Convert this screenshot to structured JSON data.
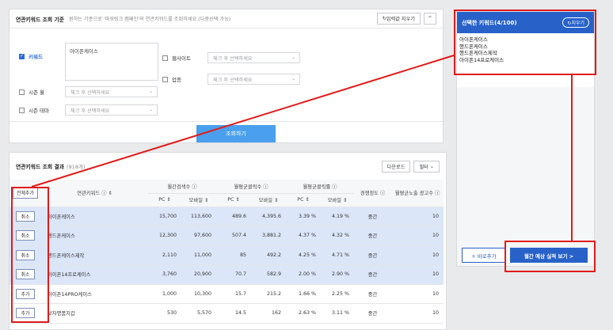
{
  "search": {
    "title": "연관키워드 조회 기준",
    "subtitle": "원하는 기준으로 '파워링크 캠페인'의 연관키워드를 조회하세요.(다중선택 가능)",
    "reset_label": "입력값 지우기",
    "collapse_label": "^",
    "keyword_label": "키워드",
    "keyword_value": "아이폰케이스",
    "website_label": "웹사이트",
    "website_placeholder": "체크 후 선택하세요",
    "business_label": "업종",
    "business_placeholder": "체크 후 선택하세요",
    "season_month_label": "시즌 월",
    "season_month_placeholder": "체크 후 선택하세요",
    "season_theme_label": "시즌 테마",
    "season_theme_placeholder": "체크 후 선택하세요",
    "search_button": "조회하기"
  },
  "results": {
    "title": "연관키워드 조회 결과",
    "count": "(918개)",
    "download_label": "다운로드",
    "filter_label": "필터",
    "add_all_label": "전체추가",
    "col_keyword": "연관키워드",
    "col_monthly_search": "월간검색수",
    "col_monthly_clicks": "월평균클릭수",
    "col_monthly_ctr": "월평균클릭률",
    "col_competition": "경쟁정도",
    "col_ad_count": "월평균노출 광고수",
    "sub_pc": "PC",
    "sub_mobile": "모바일",
    "rows": [
      {
        "action": "취소",
        "keyword": "아이폰케이스",
        "pc_search": "15,700",
        "mo_search": "113,600",
        "pc_click": "489.6",
        "mo_click": "4,395.6",
        "pc_ctr": "3.39 %",
        "mo_ctr": "4.19 %",
        "competition": "중간",
        "ads": "10",
        "selected": true
      },
      {
        "action": "취소",
        "keyword": "핸드폰케이스",
        "pc_search": "12,300",
        "mo_search": "97,600",
        "pc_click": "507.4",
        "mo_click": "3,881.2",
        "pc_ctr": "4.37 %",
        "mo_ctr": "4.32 %",
        "competition": "중간",
        "ads": "10",
        "selected": true
      },
      {
        "action": "취소",
        "keyword": "핸드폰케이스제작",
        "pc_search": "2,110",
        "mo_search": "11,000",
        "pc_click": "85",
        "mo_click": "492.2",
        "pc_ctr": "4.25 %",
        "mo_ctr": "4.71 %",
        "competition": "중간",
        "ads": "10",
        "selected": true
      },
      {
        "action": "취소",
        "keyword": "아이폰14프로케이스",
        "pc_search": "3,760",
        "mo_search": "20,900",
        "pc_click": "70.7",
        "mo_click": "582.9",
        "pc_ctr": "2.00 %",
        "mo_ctr": "2.90 %",
        "competition": "중간",
        "ads": "10",
        "selected": true
      },
      {
        "action": "추가",
        "keyword": "아이폰14PRO케이스",
        "pc_search": "1,000",
        "mo_search": "10,300",
        "pc_click": "15.7",
        "mo_click": "215.2",
        "pc_ctr": "1.66 %",
        "mo_ctr": "2.25 %",
        "competition": "중간",
        "ads": "10",
        "selected": false
      },
      {
        "action": "추가",
        "keyword": "보자명품지갑",
        "pc_search": "530",
        "mo_search": "5,570",
        "pc_click": "14.5",
        "mo_click": "162",
        "pc_ctr": "2.63 %",
        "mo_ctr": "3.11 %",
        "competition": "중간",
        "ads": "10",
        "selected": false
      }
    ]
  },
  "selected_panel": {
    "title": "선택한 키워드(4/100)",
    "reset_label": "지우기",
    "keywords": [
      "아이폰케이스",
      "핸드폰케이스",
      "핸드폰케이스제작",
      "아이폰14프로케이스"
    ],
    "add_label": "+ 바로추가",
    "forecast_label": "월간 예상 실적 보기 >"
  },
  "colors": {
    "accent": "#2862c9",
    "annotation": "#e01b1b",
    "selected_row": "#dbe6f8"
  }
}
